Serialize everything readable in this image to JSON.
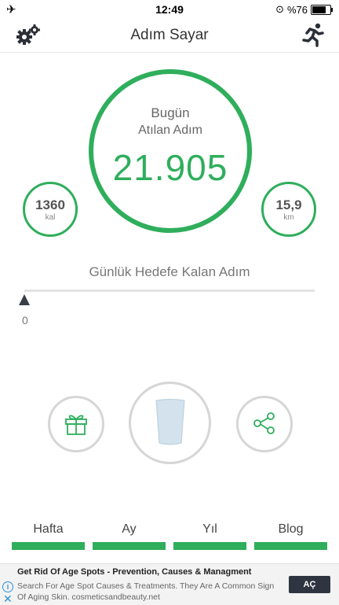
{
  "status_bar": {
    "time": "12:49",
    "battery_text": "%76",
    "battery_level": 0.76
  },
  "header": {
    "title": "Adım Sayar",
    "left_icon": "gear-icon",
    "right_icon": "running-icon"
  },
  "today": {
    "line1": "Bugün",
    "line2": "Atılan Adım",
    "steps": "21.905"
  },
  "calories": {
    "value": "1360",
    "unit": "kal"
  },
  "distance": {
    "value": "15,9",
    "unit": "km"
  },
  "goal": {
    "label": "Günlük Hedefe Kalan Adım",
    "remaining": "0",
    "progress": 0
  },
  "actions": {
    "left_icon": "gift-icon",
    "center_icon": "water-glass-icon",
    "right_icon": "share-icon"
  },
  "tabs": [
    {
      "label": "Hafta"
    },
    {
      "label": "Ay"
    },
    {
      "label": "Yıl"
    },
    {
      "label": "Blog"
    }
  ],
  "ad": {
    "title": "Get Rid Of Age Spots - Prevention, Causes & Managment",
    "body": "Search For Age Spot Causes & Treatments. They Are A Common Sign Of Aging Skin. cosmeticsandbeauty.net",
    "cta": "AÇ"
  },
  "colors": {
    "accent": "#2fae5c",
    "ring_gray": "#d6d6d6"
  }
}
